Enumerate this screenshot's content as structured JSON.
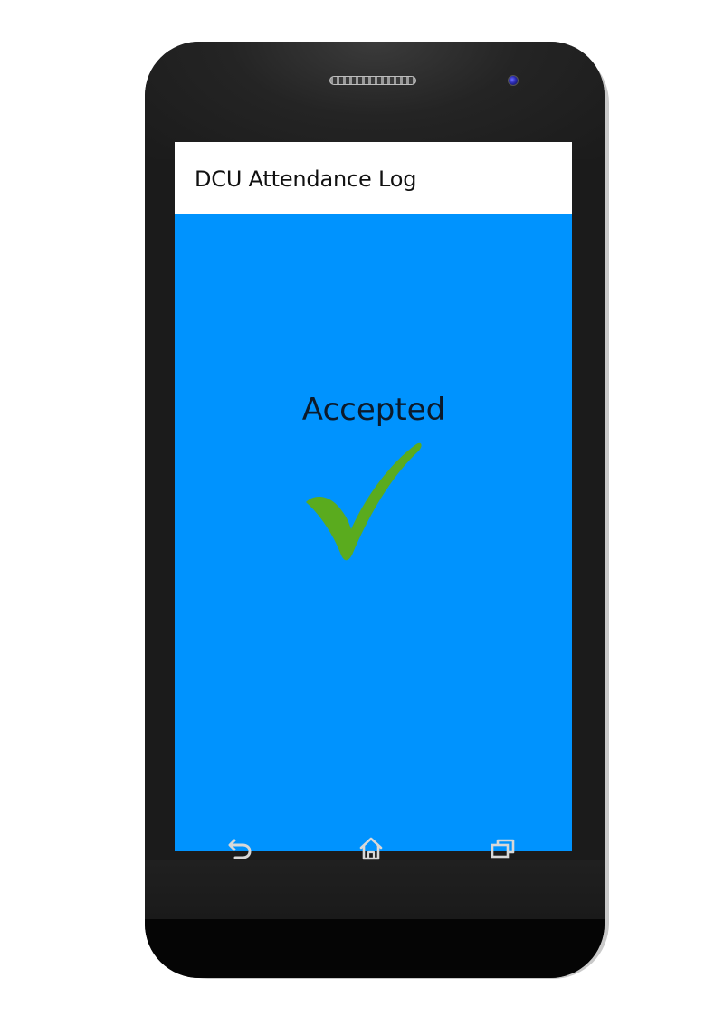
{
  "app": {
    "title": "DCU Attendance Log"
  },
  "status": {
    "message": "Accepted",
    "icon": "checkmark-icon",
    "icon_color": "#5aab1e"
  },
  "screen": {
    "background": "#0093fe"
  },
  "navigation": {
    "back_icon": "back-icon",
    "home_icon": "home-icon",
    "recents_icon": "recents-icon"
  }
}
